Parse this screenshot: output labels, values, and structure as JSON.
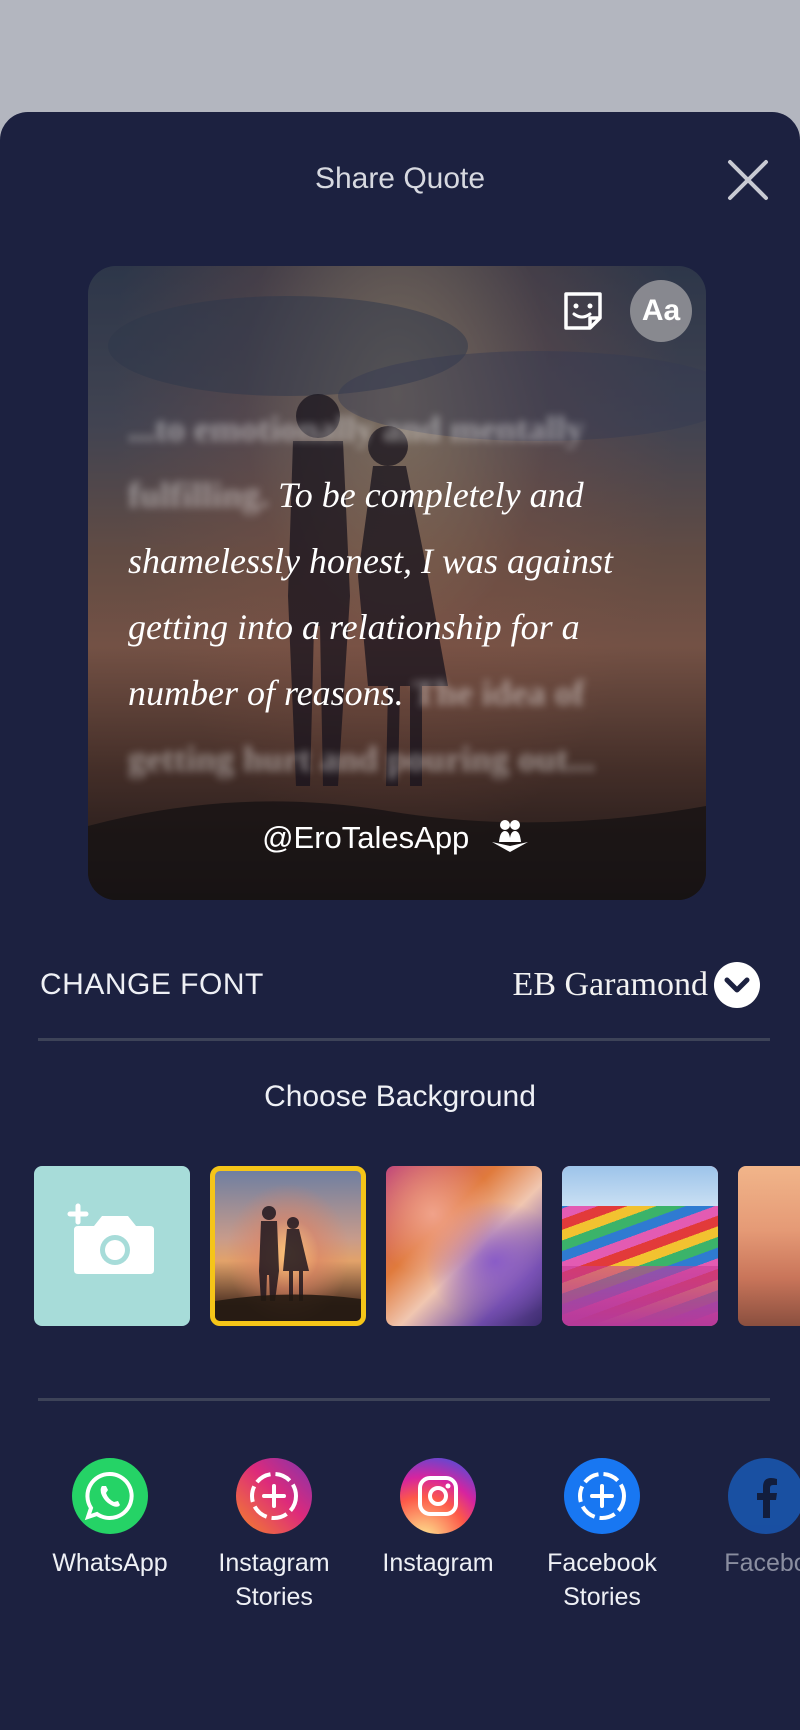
{
  "sheet": {
    "title": "Share Quote",
    "close_icon": "close-icon"
  },
  "quote_card": {
    "blur_before": "...to emotionally and mentally fulfilling.",
    "quote": "To be completely and shamelessly honest, I was against getting into a relationship for a number of reasons.",
    "blur_after": "The idea of getting hurt and pouring out...",
    "handle": "@EroTalesApp",
    "font_button_label": "Aa",
    "sticker_icon": "sticker-smile-icon",
    "logo_icon": "erotales-logo-icon"
  },
  "font": {
    "label": "CHANGE FONT",
    "value": "EB Garamond",
    "chevron_icon": "chevron-down-icon"
  },
  "background": {
    "title": "Choose Background",
    "add_icon": "add-photo-camera-icon",
    "options": [
      "couple-sunset",
      "canyon",
      "flower-fields",
      "orange-sky"
    ],
    "selected": "couple-sunset",
    "selected_color": "#f5c518"
  },
  "share": {
    "items": [
      {
        "label": "WhatsApp",
        "icon": "whatsapp-icon"
      },
      {
        "label": "Instagram Stories",
        "label_1": "Instagram",
        "label_2": "Stories",
        "icon": "instagram-stories-icon"
      },
      {
        "label": "Instagram",
        "icon": "instagram-icon"
      },
      {
        "label": "Facebook Stories",
        "label_1": "Facebook",
        "label_2": "Stories",
        "icon": "facebook-stories-icon"
      },
      {
        "label": "Facebo",
        "icon": "facebook-icon"
      }
    ]
  },
  "colors": {
    "sheet_bg": "#1c2140",
    "overlay_bg": "#b3b6bf",
    "whatsapp": "#25d366",
    "facebook": "#1877f2"
  }
}
